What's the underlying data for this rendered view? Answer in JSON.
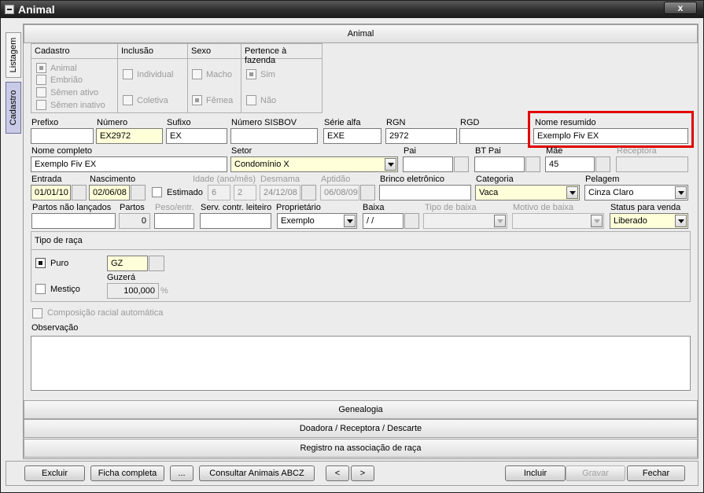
{
  "window": {
    "title": "Animal",
    "close_symbol": "x"
  },
  "side_tabs": {
    "listagem": "Listagem",
    "cadastro": "Cadastro"
  },
  "sections": {
    "animal": "Animal",
    "genealogia": "Genealogia",
    "doadora": "Doadora / Receptora / Descarte",
    "registro": "Registro na associação de raça"
  },
  "groups": {
    "cadastro": {
      "title": "Cadastro",
      "options": [
        "Animal",
        "Embrião",
        "Sêmen ativo",
        "Sêmen inativo"
      ]
    },
    "inclusao": {
      "title": "Inclusão",
      "options": [
        "Individual",
        "Coletiva"
      ]
    },
    "sexo": {
      "title": "Sexo",
      "options": [
        "Macho",
        "Fêmea"
      ]
    },
    "fazenda": {
      "title": "Pertence à fazenda",
      "options": [
        "Sim",
        "Não"
      ]
    }
  },
  "fields": {
    "prefixo": {
      "label": "Prefixo",
      "value": ""
    },
    "numero": {
      "label": "Número",
      "value": "EX2972"
    },
    "sufixo": {
      "label": "Sufixo",
      "value": "EX"
    },
    "sisbov": {
      "label": "Número SISBOV",
      "value": ""
    },
    "serie_alfa": {
      "label": "Série alfa",
      "value": "EXE"
    },
    "rgn": {
      "label": "RGN",
      "value": "2972"
    },
    "rgd": {
      "label": "RGD",
      "value": ""
    },
    "nome_resumido": {
      "label": "Nome resumido",
      "value": "Exemplo Fiv EX"
    },
    "nome_completo": {
      "label": "Nome completo",
      "value": "Exemplo Fiv EX"
    },
    "setor": {
      "label": "Setor",
      "value": "Condomínio X"
    },
    "pai": {
      "label": "Pai",
      "value": ""
    },
    "bt_pai": {
      "label": "BT Pai",
      "value": ""
    },
    "mae": {
      "label": "Mãe",
      "value": "45"
    },
    "receptora": {
      "label": "Receptora",
      "value": ""
    },
    "entrada": {
      "label": "Entrada",
      "value": "01/01/10"
    },
    "nascimento": {
      "label": "Nascimento",
      "value": "02/06/08"
    },
    "estimado": {
      "label": "Estimado"
    },
    "idade": {
      "label": "Idade (ano/mês)",
      "ano": "6",
      "mes": "2"
    },
    "desmama": {
      "label": "Desmama",
      "value": "24/12/08"
    },
    "aptidao": {
      "label": "Aptidão",
      "value": "06/08/09"
    },
    "brinco": {
      "label": "Brinco eletrônico",
      "value": ""
    },
    "categoria": {
      "label": "Categoria",
      "value": "Vaca"
    },
    "pelagem": {
      "label": "Pelagem",
      "value": "Cinza Claro"
    },
    "partos_nao": {
      "label": "Partos não lançados",
      "value": ""
    },
    "partos": {
      "label": "Partos",
      "value": "0"
    },
    "peso": {
      "label": "Peso/entr.",
      "value": ""
    },
    "serv": {
      "label": "Serv. contr. leiteiro",
      "value": ""
    },
    "proprietario": {
      "label": "Proprietário",
      "value": "Exemplo"
    },
    "baixa": {
      "label": "Baixa",
      "value": " / /"
    },
    "tipo_baixa": {
      "label": "Tipo de baixa",
      "value": ""
    },
    "motivo_baixa": {
      "label": "Motivo de baixa",
      "value": ""
    },
    "status_venda": {
      "label": "Status para venda",
      "value": "Liberado"
    }
  },
  "raca": {
    "title": "Tipo de raça",
    "puro": "Puro",
    "mestico": "Mestiço",
    "code": "GZ",
    "breed_name": "Guzerá",
    "percent": "100,000",
    "percent_sign": "%"
  },
  "composicao": "Composição racial automática",
  "observacao": {
    "label": "Observação",
    "value": ""
  },
  "buttons": {
    "excluir": "Excluir",
    "ficha": "Ficha completa",
    "dots": "...",
    "consultar": "Consultar Animais ABCZ",
    "prev": "<",
    "next": ">",
    "incluir": "Incluir",
    "gravar": "Gravar",
    "fechar": "Fechar"
  },
  "colors": {
    "highlight": "#e00000",
    "required_field": "#ffffd9",
    "active_tab": "#c9cbe6"
  }
}
